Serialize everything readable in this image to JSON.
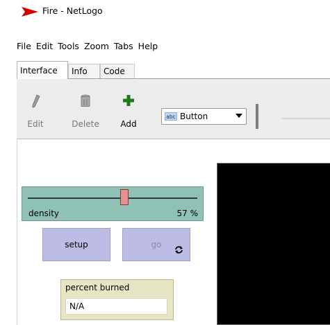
{
  "window": {
    "title": "Fire - NetLogo"
  },
  "menu": [
    {
      "label": "File"
    },
    {
      "label": "Edit"
    },
    {
      "label": "Tools"
    },
    {
      "label": "Zoom"
    },
    {
      "label": "Tabs"
    },
    {
      "label": "Help"
    }
  ],
  "tabs": [
    {
      "label": "Interface",
      "selected": true
    },
    {
      "label": "Info",
      "selected": false
    },
    {
      "label": "Code",
      "selected": false
    }
  ],
  "toolbar": {
    "edit_label": "Edit",
    "delete_label": "Delete",
    "add_label": "Add",
    "widget_type_icon_text": "abc",
    "widget_type_value": "Button"
  },
  "widgets": {
    "slider": {
      "name": "density",
      "value_text": "57 %",
      "value": 57,
      "min": 0,
      "max": 100
    },
    "setup_button": {
      "label": "setup"
    },
    "go_button": {
      "label": "go",
      "forever": true
    },
    "monitor": {
      "label": "percent burned",
      "value": "N/A"
    }
  },
  "colors": {
    "app_icon": "#d40000",
    "slider_bg": "#8fc1b4",
    "button_bg": "#bcbce6",
    "monitor_bg": "#e6e6c4",
    "add_icon": "#1e7b1e",
    "view_bg": "#000000"
  }
}
